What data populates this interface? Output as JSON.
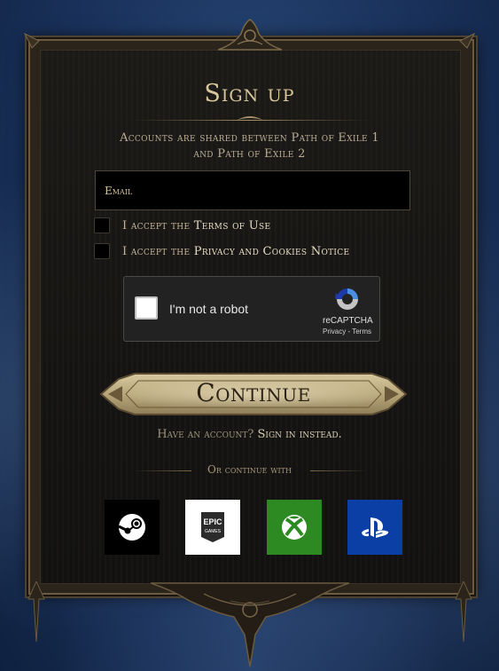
{
  "title": "Sign up",
  "subtitle_line1": "Accounts are shared between Path of Exile 1",
  "subtitle_line2": "and Path of Exile 2",
  "email_placeholder": "Email",
  "terms": {
    "prefix": "I accept the",
    "link": "Terms of Use"
  },
  "privacy": {
    "prefix": "I accept the",
    "link": "Privacy and Cookies Notice"
  },
  "captcha": {
    "label": "I'm not a robot",
    "brand": "reCAPTCHA",
    "privacy": "Privacy",
    "sep": " - ",
    "terms": "Terms"
  },
  "continue_label": "Continue",
  "have_account": {
    "text": "Have an account?",
    "link": "Sign in instead."
  },
  "or_continue": "Or continue with",
  "providers": [
    {
      "name": "steam",
      "icon": "steam-icon",
      "color": "#000000"
    },
    {
      "name": "epic",
      "icon": "epic-games-icon",
      "label": "EPIC",
      "sub": "GAMES",
      "color": "#ffffff"
    },
    {
      "name": "xbox",
      "icon": "xbox-icon",
      "color": "#2d8a23"
    },
    {
      "name": "playstation",
      "icon": "playstation-icon",
      "color": "#0b3fa6"
    }
  ],
  "colors": {
    "gold_text": "#d9c79b",
    "panel": "#161513",
    "frame": "#6b5a3f",
    "background": "#1c3560"
  }
}
